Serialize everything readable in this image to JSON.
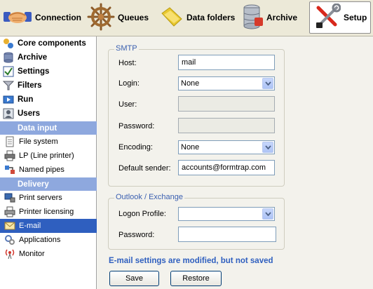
{
  "toolbar": {
    "connection": "Connection",
    "queues": "Queues",
    "data_folders": "Data folders",
    "archive": "Archive",
    "setup": "Setup"
  },
  "sidebar": {
    "top_items": [
      "Core components",
      "Archive",
      "Settings",
      "Filters",
      "Run",
      "Users"
    ],
    "data_input_header": "Data input",
    "data_input_items": [
      "File system",
      "LP (Line printer)",
      "Named pipes"
    ],
    "delivery_header": "Delivery",
    "delivery_items": [
      "Print servers",
      "Printer licensing",
      "E-mail",
      "Applications",
      "Monitor"
    ],
    "selected": "E-mail"
  },
  "smtp": {
    "title": "SMTP",
    "host_label": "Host:",
    "host_value": "mail",
    "login_label": "Login:",
    "login_value": "None",
    "user_label": "User:",
    "user_value": "",
    "password_label": "Password:",
    "password_value": "",
    "encoding_label": "Encoding:",
    "encoding_value": "None",
    "sender_label": "Default sender:",
    "sender_value": "accounts@formtrap.com"
  },
  "outlook": {
    "title": "Outlook / Exchange",
    "profile_label": "Logon Profile:",
    "profile_value": "",
    "password_label": "Password:",
    "password_value": ""
  },
  "status_message": "E-mail settings are modified, but not saved",
  "buttons": {
    "save": "Save",
    "restore": "Restore"
  },
  "colors": {
    "accent": "#2f5fbf",
    "section_header": "#8ea8de",
    "group_title": "#3a5fb0"
  }
}
